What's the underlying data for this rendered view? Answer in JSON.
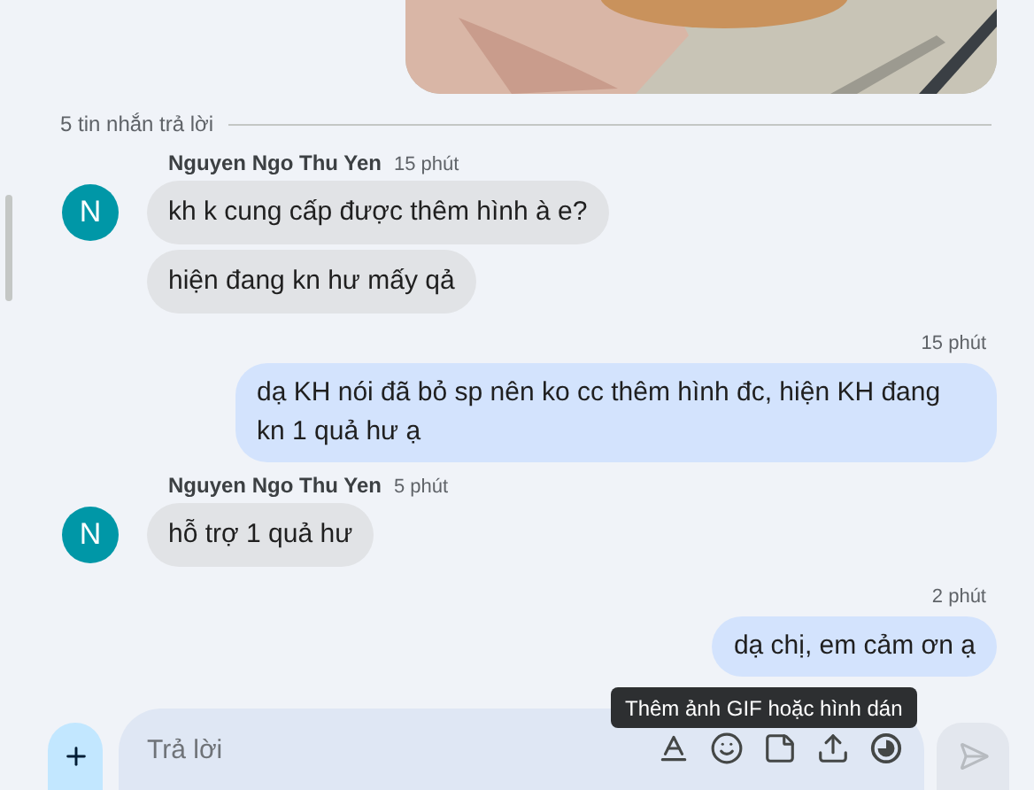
{
  "thread": {
    "reply_count": "5 tin nhắn trả lời"
  },
  "messages": [
    {
      "kind": "incoming",
      "sender": "Nguyen Ngo Thu Yen",
      "time": "15 phút",
      "avatar": "N",
      "bubbles": [
        "kh k cung cấp được thêm hình à e?",
        "hiện đang kn hư mấy qả"
      ]
    },
    {
      "kind": "outgoing",
      "time": "15 phút",
      "bubbles": [
        "dạ KH nói đã bỏ sp nên ko cc thêm hình đc, hiện KH đang kn 1 quả hư ạ"
      ]
    },
    {
      "kind": "incoming",
      "sender": "Nguyen Ngo Thu Yen",
      "time": "5 phút",
      "avatar": "N",
      "bubbles": [
        "hỗ trợ 1 quả hư"
      ]
    },
    {
      "kind": "outgoing",
      "time": "2 phút",
      "bubbles": [
        "dạ chị, em cảm ơn ạ"
      ]
    }
  ],
  "tooltip": "Thêm ảnh GIF hoặc hình dán",
  "composer": {
    "placeholder": "Trả lời"
  }
}
